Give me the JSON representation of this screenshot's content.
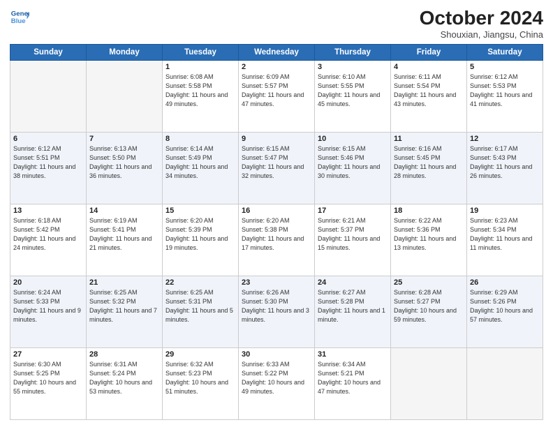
{
  "header": {
    "logo_line1": "General",
    "logo_line2": "Blue",
    "month": "October 2024",
    "location": "Shouxian, Jiangsu, China"
  },
  "weekdays": [
    "Sunday",
    "Monday",
    "Tuesday",
    "Wednesday",
    "Thursday",
    "Friday",
    "Saturday"
  ],
  "weeks": [
    [
      {
        "day": "",
        "text": ""
      },
      {
        "day": "",
        "text": ""
      },
      {
        "day": "1",
        "text": "Sunrise: 6:08 AM\nSunset: 5:58 PM\nDaylight: 11 hours and 49 minutes."
      },
      {
        "day": "2",
        "text": "Sunrise: 6:09 AM\nSunset: 5:57 PM\nDaylight: 11 hours and 47 minutes."
      },
      {
        "day": "3",
        "text": "Sunrise: 6:10 AM\nSunset: 5:55 PM\nDaylight: 11 hours and 45 minutes."
      },
      {
        "day": "4",
        "text": "Sunrise: 6:11 AM\nSunset: 5:54 PM\nDaylight: 11 hours and 43 minutes."
      },
      {
        "day": "5",
        "text": "Sunrise: 6:12 AM\nSunset: 5:53 PM\nDaylight: 11 hours and 41 minutes."
      }
    ],
    [
      {
        "day": "6",
        "text": "Sunrise: 6:12 AM\nSunset: 5:51 PM\nDaylight: 11 hours and 38 minutes."
      },
      {
        "day": "7",
        "text": "Sunrise: 6:13 AM\nSunset: 5:50 PM\nDaylight: 11 hours and 36 minutes."
      },
      {
        "day": "8",
        "text": "Sunrise: 6:14 AM\nSunset: 5:49 PM\nDaylight: 11 hours and 34 minutes."
      },
      {
        "day": "9",
        "text": "Sunrise: 6:15 AM\nSunset: 5:47 PM\nDaylight: 11 hours and 32 minutes."
      },
      {
        "day": "10",
        "text": "Sunrise: 6:15 AM\nSunset: 5:46 PM\nDaylight: 11 hours and 30 minutes."
      },
      {
        "day": "11",
        "text": "Sunrise: 6:16 AM\nSunset: 5:45 PM\nDaylight: 11 hours and 28 minutes."
      },
      {
        "day": "12",
        "text": "Sunrise: 6:17 AM\nSunset: 5:43 PM\nDaylight: 11 hours and 26 minutes."
      }
    ],
    [
      {
        "day": "13",
        "text": "Sunrise: 6:18 AM\nSunset: 5:42 PM\nDaylight: 11 hours and 24 minutes."
      },
      {
        "day": "14",
        "text": "Sunrise: 6:19 AM\nSunset: 5:41 PM\nDaylight: 11 hours and 21 minutes."
      },
      {
        "day": "15",
        "text": "Sunrise: 6:20 AM\nSunset: 5:39 PM\nDaylight: 11 hours and 19 minutes."
      },
      {
        "day": "16",
        "text": "Sunrise: 6:20 AM\nSunset: 5:38 PM\nDaylight: 11 hours and 17 minutes."
      },
      {
        "day": "17",
        "text": "Sunrise: 6:21 AM\nSunset: 5:37 PM\nDaylight: 11 hours and 15 minutes."
      },
      {
        "day": "18",
        "text": "Sunrise: 6:22 AM\nSunset: 5:36 PM\nDaylight: 11 hours and 13 minutes."
      },
      {
        "day": "19",
        "text": "Sunrise: 6:23 AM\nSunset: 5:34 PM\nDaylight: 11 hours and 11 minutes."
      }
    ],
    [
      {
        "day": "20",
        "text": "Sunrise: 6:24 AM\nSunset: 5:33 PM\nDaylight: 11 hours and 9 minutes."
      },
      {
        "day": "21",
        "text": "Sunrise: 6:25 AM\nSunset: 5:32 PM\nDaylight: 11 hours and 7 minutes."
      },
      {
        "day": "22",
        "text": "Sunrise: 6:25 AM\nSunset: 5:31 PM\nDaylight: 11 hours and 5 minutes."
      },
      {
        "day": "23",
        "text": "Sunrise: 6:26 AM\nSunset: 5:30 PM\nDaylight: 11 hours and 3 minutes."
      },
      {
        "day": "24",
        "text": "Sunrise: 6:27 AM\nSunset: 5:28 PM\nDaylight: 11 hours and 1 minute."
      },
      {
        "day": "25",
        "text": "Sunrise: 6:28 AM\nSunset: 5:27 PM\nDaylight: 10 hours and 59 minutes."
      },
      {
        "day": "26",
        "text": "Sunrise: 6:29 AM\nSunset: 5:26 PM\nDaylight: 10 hours and 57 minutes."
      }
    ],
    [
      {
        "day": "27",
        "text": "Sunrise: 6:30 AM\nSunset: 5:25 PM\nDaylight: 10 hours and 55 minutes."
      },
      {
        "day": "28",
        "text": "Sunrise: 6:31 AM\nSunset: 5:24 PM\nDaylight: 10 hours and 53 minutes."
      },
      {
        "day": "29",
        "text": "Sunrise: 6:32 AM\nSunset: 5:23 PM\nDaylight: 10 hours and 51 minutes."
      },
      {
        "day": "30",
        "text": "Sunrise: 6:33 AM\nSunset: 5:22 PM\nDaylight: 10 hours and 49 minutes."
      },
      {
        "day": "31",
        "text": "Sunrise: 6:34 AM\nSunset: 5:21 PM\nDaylight: 10 hours and 47 minutes."
      },
      {
        "day": "",
        "text": ""
      },
      {
        "day": "",
        "text": ""
      }
    ]
  ],
  "row_styles": [
    "row-white",
    "row-blue",
    "row-white",
    "row-blue",
    "row-white"
  ]
}
